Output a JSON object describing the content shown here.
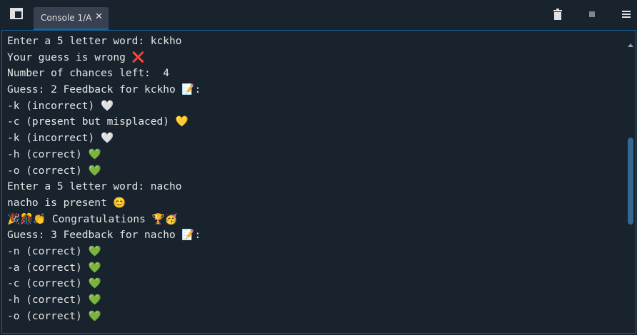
{
  "tab": {
    "label": "Console 1/A",
    "close": "✕"
  },
  "toolbar": {
    "icons": [
      "trash-icon",
      "stop-icon",
      "menu-icon"
    ]
  },
  "console": {
    "lines": [
      "Enter a 5 letter word: kckho",
      "Your guess is wrong ❌",
      "Number of chances left:  4",
      "Guess: 2 Feedback for kckho 📝:",
      "-k (incorrect) 🤍",
      "-c (present but misplaced) 💛",
      "-k (incorrect) 🤍",
      "-h (correct) 💚",
      "-o (correct) 💚",
      "Enter a 5 letter word: nacho",
      "nacho is present 😊",
      "🎉🎊👏 Congratulations 🏆🥳",
      "Guess: 3 Feedback for nacho 📝:",
      "-n (correct) 💚",
      "-a (correct) 💚",
      "-c (correct) 💚",
      "-h (correct) 💚",
      "-o (correct) 💚"
    ]
  },
  "colors": {
    "background": "#19232d",
    "tab": "#37414f",
    "accent": "#1464a0",
    "scroll_thumb": "#346792",
    "text": "#e6e6e6"
  }
}
